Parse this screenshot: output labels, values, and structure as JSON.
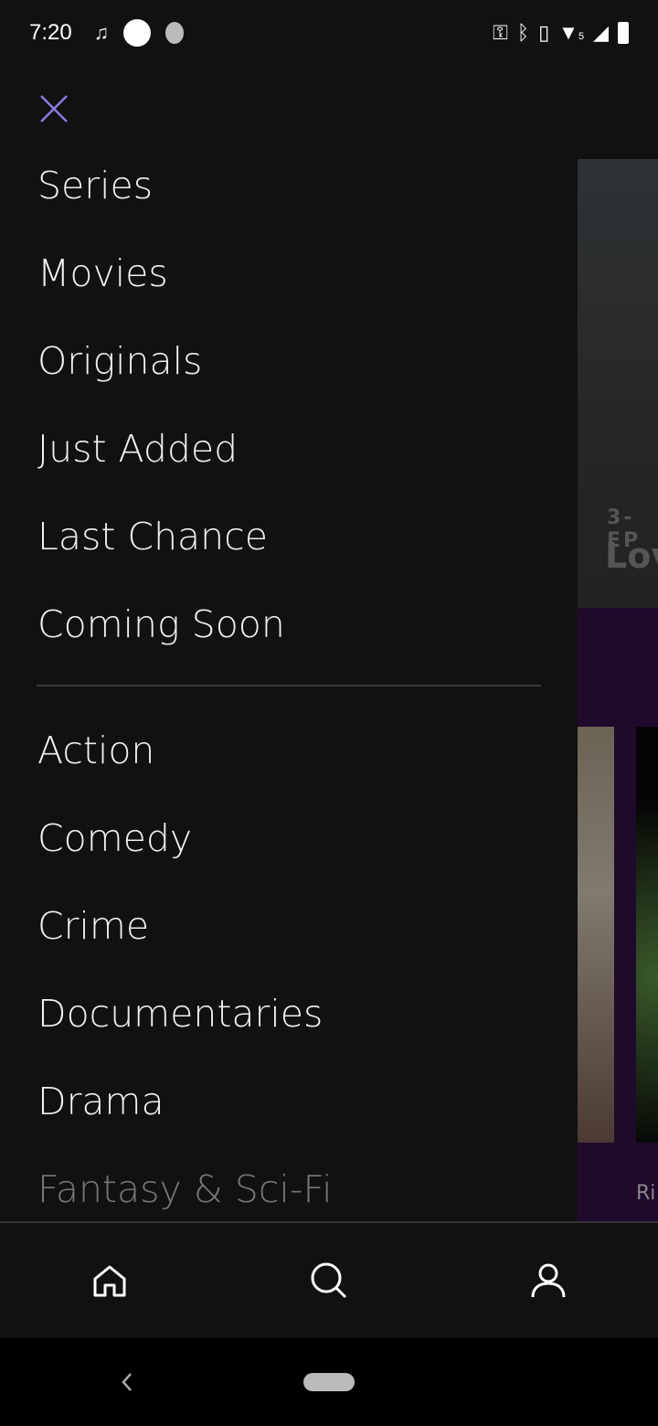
{
  "status_bar": {
    "time": "7:20",
    "network_label": "5"
  },
  "close_icon": "close-icon",
  "accent": "#8a7ae0",
  "menu": {
    "primary": [
      "Series",
      "Movies",
      "Originals",
      "Just Added",
      "Last Chance",
      "Coming Soon"
    ],
    "genres": [
      "Action",
      "Comedy",
      "Crime",
      "Documentaries",
      "Drama",
      "Fantasy & Sci-Fi"
    ]
  },
  "background": {
    "hero_kicker": "3-EP",
    "hero_title": "Lov",
    "row_caption": "Ri"
  },
  "bottom_nav": [
    {
      "icon": "home-icon"
    },
    {
      "icon": "search-icon"
    },
    {
      "icon": "profile-icon"
    }
  ]
}
